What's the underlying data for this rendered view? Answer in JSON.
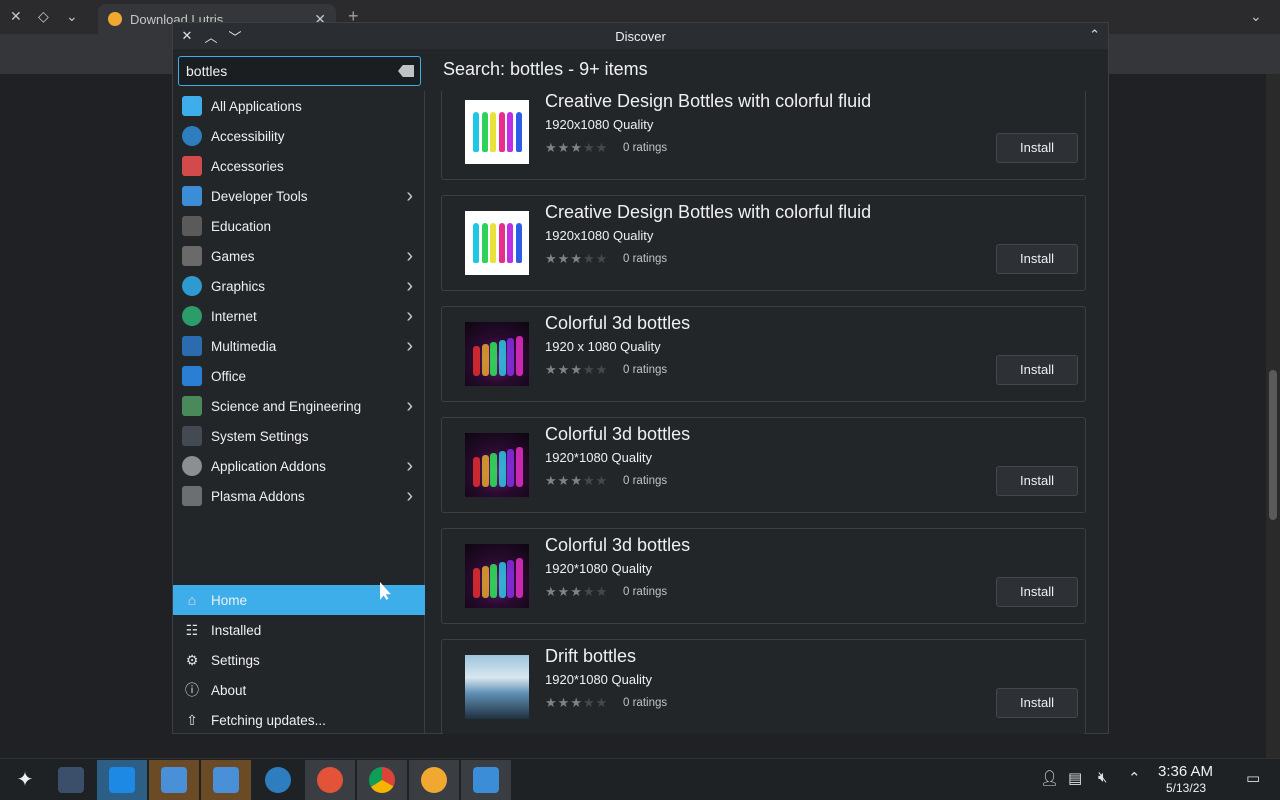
{
  "browser": {
    "tab_title": "Download Lutris",
    "url_fragment": "http"
  },
  "window": {
    "title": "Discover"
  },
  "search": {
    "value": "bottles"
  },
  "heading": "Search: bottles - 9+ items",
  "categories": [
    {
      "label": "All Applications",
      "icon": "all-apps-icon",
      "has_children": false
    },
    {
      "label": "Accessibility",
      "icon": "accessibility-icon",
      "has_children": false
    },
    {
      "label": "Accessories",
      "icon": "accessories-icon",
      "has_children": false
    },
    {
      "label": "Developer Tools",
      "icon": "developer-tools-icon",
      "has_children": true
    },
    {
      "label": "Education",
      "icon": "education-icon",
      "has_children": false
    },
    {
      "label": "Games",
      "icon": "games-icon",
      "has_children": true
    },
    {
      "label": "Graphics",
      "icon": "graphics-icon",
      "has_children": true
    },
    {
      "label": "Internet",
      "icon": "internet-icon",
      "has_children": true
    },
    {
      "label": "Multimedia",
      "icon": "multimedia-icon",
      "has_children": true
    },
    {
      "label": "Office",
      "icon": "office-icon",
      "has_children": false
    },
    {
      "label": "Science and Engineering",
      "icon": "science-icon",
      "has_children": true
    },
    {
      "label": "System Settings",
      "icon": "system-settings-icon",
      "has_children": false
    },
    {
      "label": "Application Addons",
      "icon": "addons-icon",
      "has_children": true
    },
    {
      "label": "Plasma Addons",
      "icon": "plasma-addons-icon",
      "has_children": true
    }
  ],
  "nav": [
    {
      "label": "Home",
      "icon": "home-icon",
      "active": true
    },
    {
      "label": "Installed",
      "icon": "installed-icon",
      "active": false
    },
    {
      "label": "Settings",
      "icon": "settings-icon",
      "active": false
    },
    {
      "label": "About",
      "icon": "info-icon",
      "active": false
    },
    {
      "label": "Fetching updates...",
      "icon": "updates-icon",
      "active": false
    }
  ],
  "results": [
    {
      "name": "Creative Design Bottles with colorful fluid",
      "subtitle": "1920x1080 Quality",
      "rating_stars": 3,
      "ratings": "0 ratings",
      "install": "Install",
      "thumb": "bottles"
    },
    {
      "name": "Creative Design Bottles with colorful fluid",
      "subtitle": "1920x1080 Quality",
      "rating_stars": 3,
      "ratings": "0 ratings",
      "install": "Install",
      "thumb": "bottles"
    },
    {
      "name": "Colorful 3d bottles",
      "subtitle": "1920 x 1080 Quality",
      "rating_stars": 3,
      "ratings": "0 ratings",
      "install": "Install",
      "thumb": "3d"
    },
    {
      "name": "Colorful 3d bottles",
      "subtitle": "1920*1080 Quality",
      "rating_stars": 3,
      "ratings": "0 ratings",
      "install": "Install",
      "thumb": "3d"
    },
    {
      "name": "Colorful 3d bottles",
      "subtitle": "1920*1080 Quality",
      "rating_stars": 3,
      "ratings": "0 ratings",
      "install": "Install",
      "thumb": "3d"
    },
    {
      "name": "Drift bottles",
      "subtitle": "1920*1080 Quality",
      "rating_stars": 3,
      "ratings": "0 ratings",
      "install": "Install",
      "thumb": "drift"
    }
  ],
  "taskbar": {
    "time": "3:36 AM",
    "date": "5/13/23"
  },
  "colors": {
    "accent": "#3daee9",
    "window_bg": "#232629"
  }
}
